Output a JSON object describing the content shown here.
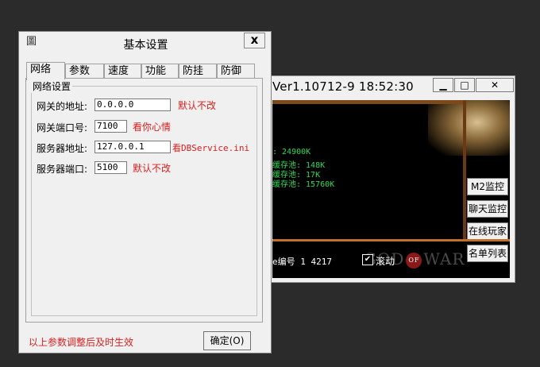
{
  "back_window": {
    "title": "Ver1.10712-9 18:52:30",
    "minimize": "▁",
    "restore": "□",
    "close": "✕",
    "stats": [
      ": 24900K",
      "缓存池: 148K",
      "缓存池: 17K",
      "缓存池: 15760K"
    ],
    "side_buttons": [
      "M2监控",
      "聊天监控",
      "在线玩家",
      "名单列表"
    ],
    "player_no_label": "e编号 1  4217",
    "scroll_label": "滚动",
    "scroll_checked": "✔",
    "logo_left": "GOD",
    "logo_of": "OF",
    "logo_right": "WAR"
  },
  "dialog": {
    "title": "基本设置",
    "close": "x",
    "icon": "圖",
    "tabs": [
      "网络",
      "参数",
      "速度",
      "功能",
      "防挂",
      "防御"
    ],
    "active_tab": "网络",
    "group_title": "网络设置",
    "fields": [
      {
        "label": "网关的地址:",
        "value": "0.0.0.0",
        "hint": "默认不改"
      },
      {
        "label": "网关端口号:",
        "value": "7100",
        "hint": "看你心情"
      },
      {
        "label": "服务器地址:",
        "value": "127.0.0.1",
        "hint": "看DBService.ini"
      },
      {
        "label": "服务器端口:",
        "value": "5100",
        "hint": "默认不改"
      }
    ],
    "status_note": "以上参数调整后及时生效",
    "ok_label": "确定(O)"
  }
}
